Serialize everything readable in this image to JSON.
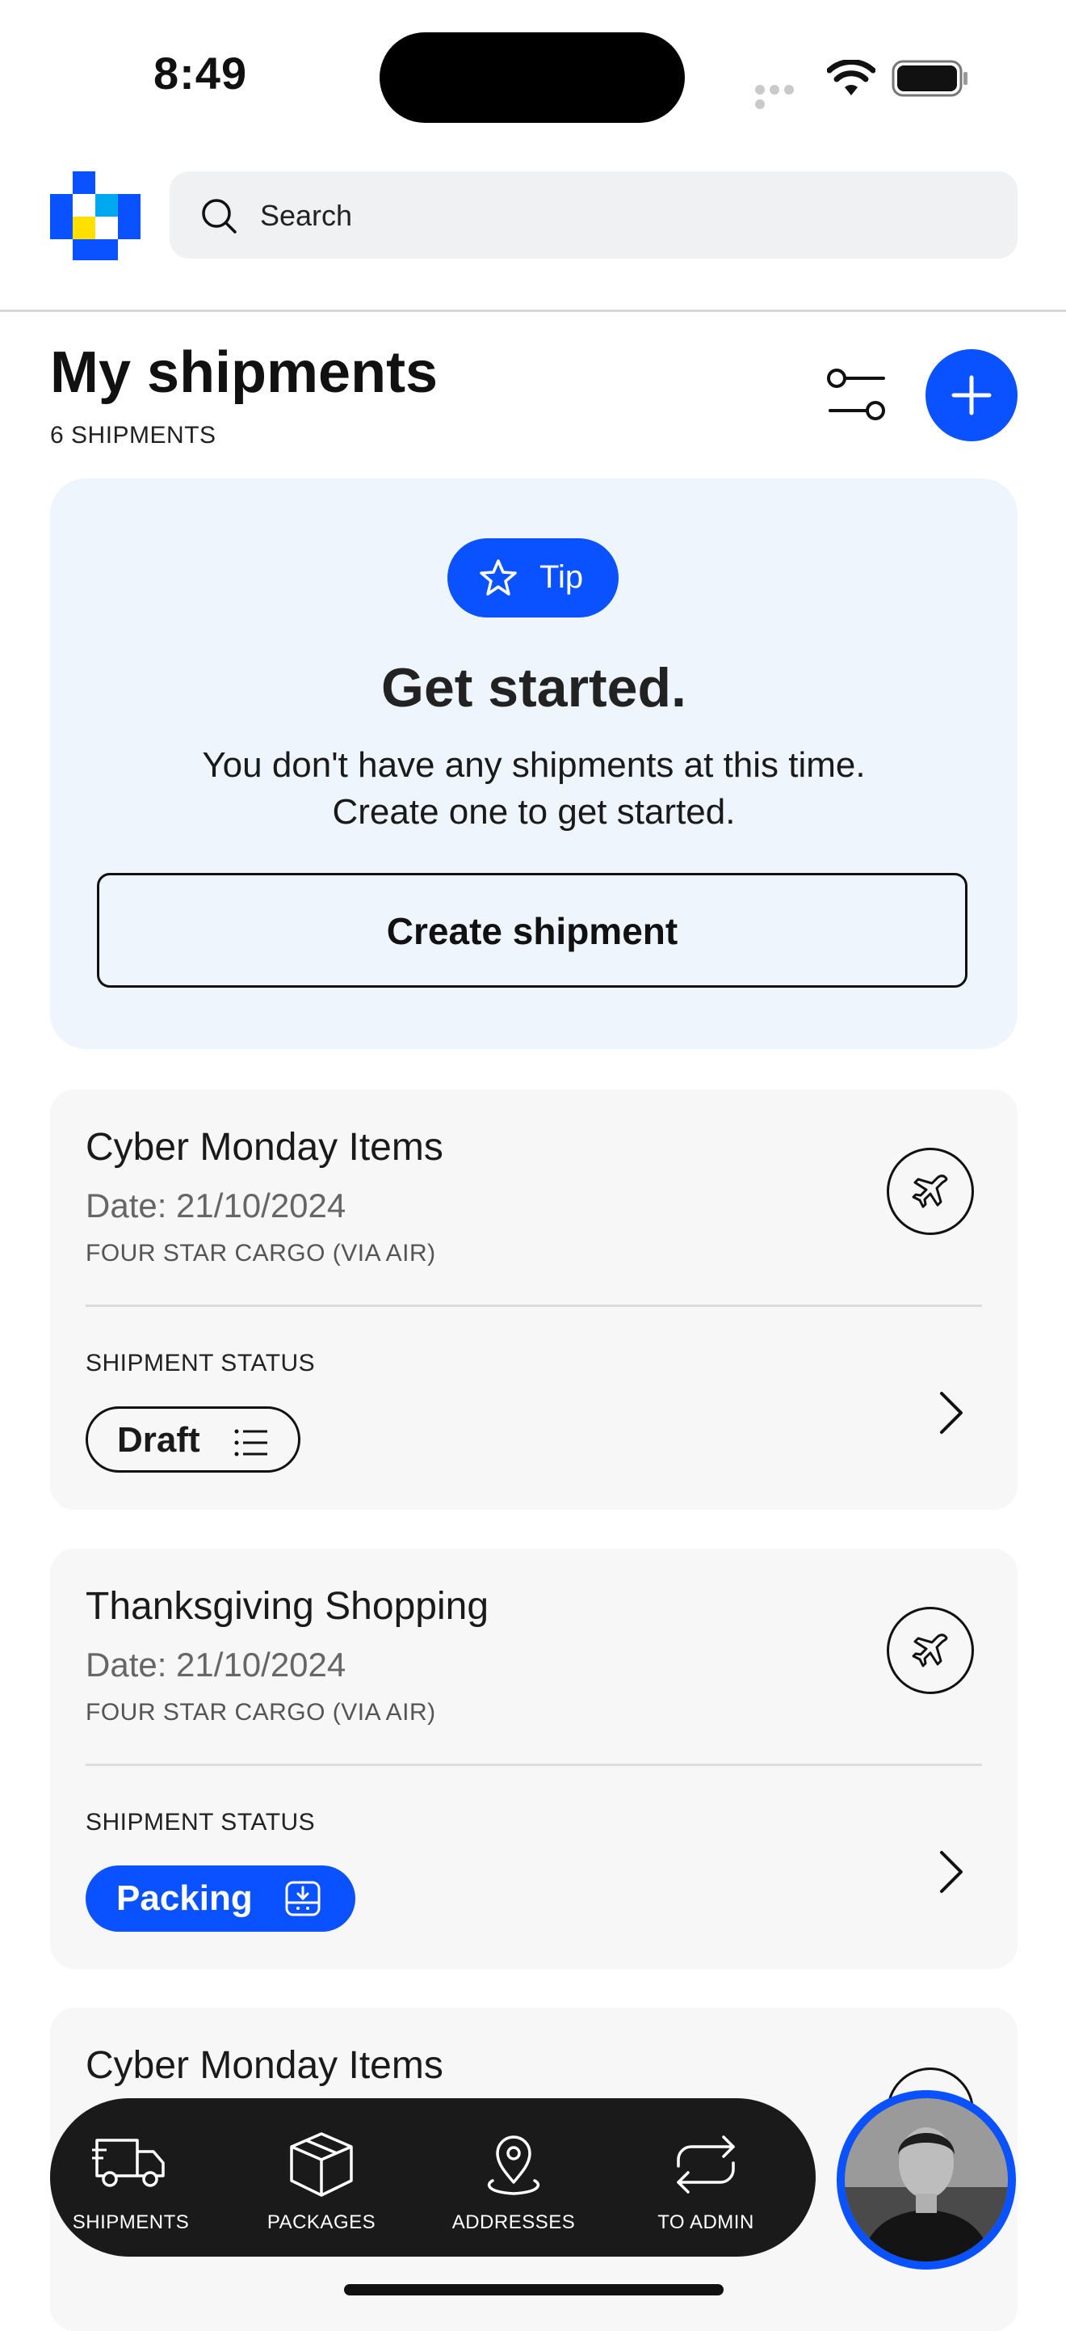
{
  "status_bar": {
    "time": "8:49"
  },
  "header": {
    "search_placeholder": "Search"
  },
  "page": {
    "title": "My shipments",
    "count": "6 SHIPMENTS"
  },
  "tip": {
    "badge": "Tip",
    "heading": "Get started.",
    "body_line1": "You don't have any shipments at this time.",
    "body_line2": "Create one to get started.",
    "button": "Create shipment"
  },
  "shipments": [
    {
      "name": "Cyber Monday Items",
      "date": "Date: 21/10/2024",
      "carrier": "FOUR STAR CARGO (VIA AIR)",
      "status_label": "SHIPMENT STATUS",
      "status": "Draft",
      "status_icon": "list-icon"
    },
    {
      "name": "Thanksgiving Shopping",
      "date": "Date: 21/10/2024",
      "carrier": "FOUR STAR CARGO (VIA AIR)",
      "status_label": "SHIPMENT STATUS",
      "status": "Packing",
      "status_icon": "package-in-icon"
    },
    {
      "name": "Cyber Monday Items"
    }
  ],
  "nav": {
    "items": [
      {
        "label": "SHIPMENTS",
        "icon": "truck-icon"
      },
      {
        "label": "PACKAGES",
        "icon": "box-icon"
      },
      {
        "label": "ADDRESSES",
        "icon": "pin-icon"
      },
      {
        "label": "TO ADMIN",
        "icon": "swap-icon"
      }
    ]
  },
  "colors": {
    "accent": "#0a52ff",
    "tip_bg": "#eef5fd",
    "card_bg": "#f7f7f7",
    "nav_bg": "#1a1a1a"
  }
}
